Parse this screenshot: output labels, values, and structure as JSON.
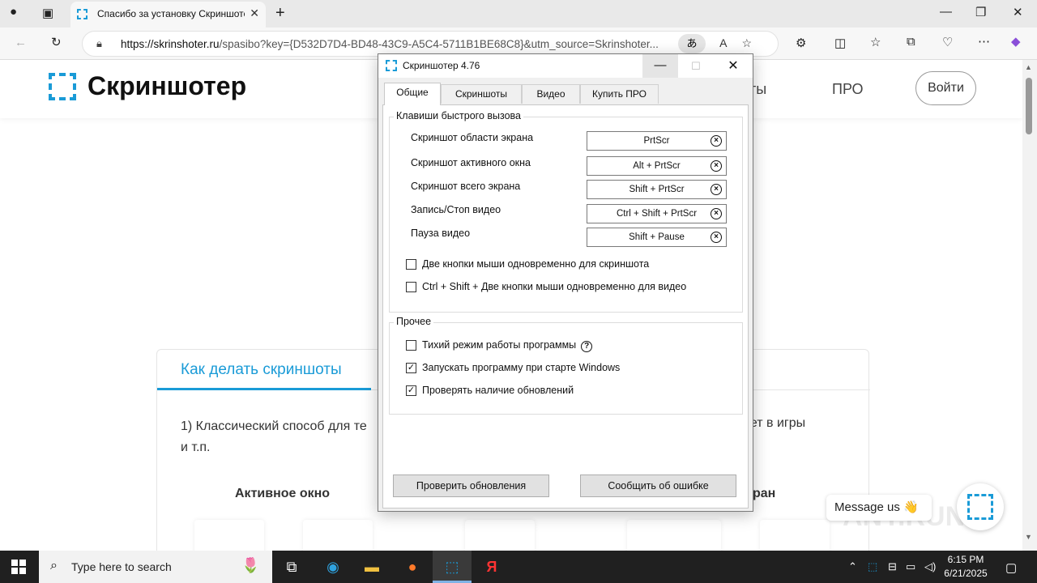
{
  "browser": {
    "tab_title": "Спасибо за установку Скриншотера",
    "url_host": "https://skrinshoter.ru",
    "url_rest": "/spasibo?key={D532D7D4-BD48-43C9-A5C4-5711B1BE68C8}&utm_source=Skrinshoter..."
  },
  "site": {
    "logo_text": "Скриншотер",
    "nav_partial": "ты",
    "nav_pro": "ПРО",
    "login": "Войти",
    "tab_label": "Как делать скриншоты",
    "text_left": "1) Классический способ для те",
    "text_right": "ает в игры",
    "text_line2": "и т.п.",
    "col_active": "Активное окно",
    "col_right": "ран",
    "message": "Message us 👋"
  },
  "dialog": {
    "title": "Скриншотер 4.76",
    "tabs": [
      "Общие",
      "Скриншоты",
      "Видео",
      "Купить ПРО"
    ],
    "hotkeys_group": "Клавиши быстрого вызова",
    "hotkeys": [
      {
        "label": "Скриншот области экрана",
        "key": "PrtScr"
      },
      {
        "label": "Скриншот активного окна",
        "key": "Alt + PrtScr"
      },
      {
        "label": "Скриншот всего экрана",
        "key": "Shift + PrtScr"
      },
      {
        "label": "Запись/Стоп видео",
        "key": "Ctrl + Shift + PrtScr"
      },
      {
        "label": "Пауза видео",
        "key": "Shift + Pause"
      }
    ],
    "hotkey_checks": [
      {
        "label": "Две кнопки мыши одновременно для скриншота",
        "checked": false
      },
      {
        "label": "Ctrl + Shift + Две кнопки мыши одновременно для видео",
        "checked": false
      }
    ],
    "other_group": "Прочее",
    "other_checks": [
      {
        "label": "Тихий режим работы программы",
        "checked": false
      },
      {
        "label": "Запускать программу при старте Windows",
        "checked": true
      },
      {
        "label": "Проверять наличие обновлений",
        "checked": true
      }
    ],
    "btn_check_updates": "Проверить обновления",
    "btn_report_error": "Сообщить об ошибке"
  },
  "taskbar": {
    "search_placeholder": "Type here to search",
    "time": "6:15 PM",
    "date": "6/21/2025"
  },
  "colors": {
    "accent": "#1a9bd7",
    "taskbar": "#202020"
  }
}
